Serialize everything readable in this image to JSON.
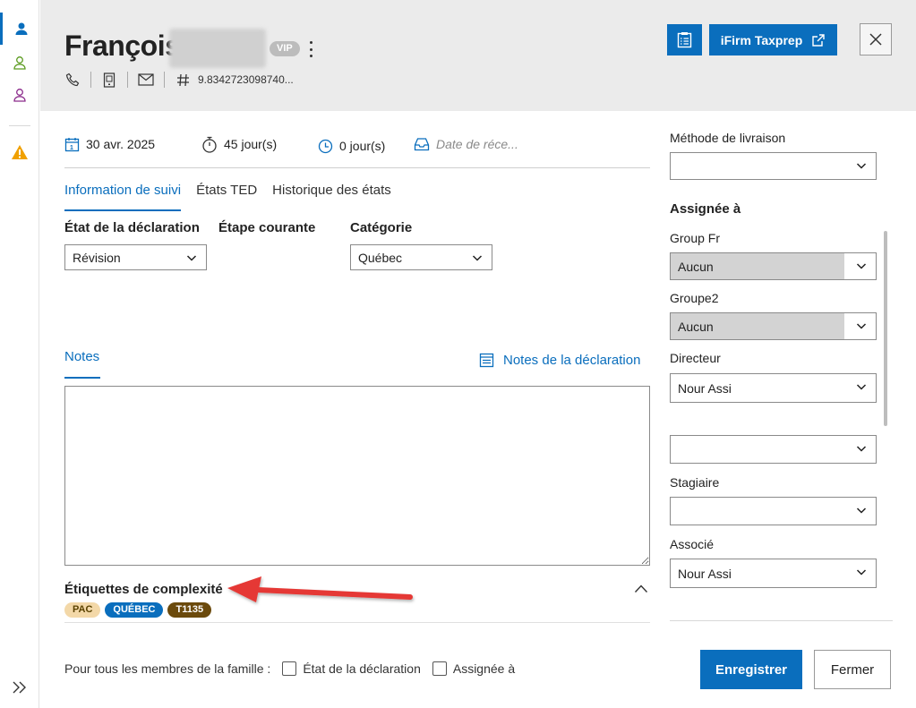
{
  "header": {
    "client_first_name": "François",
    "vip_badge": "VIP",
    "client_id": "9.8342723098740..."
  },
  "toolbar": {
    "ifirm_label": "iFirm Taxprep"
  },
  "dates": {
    "date": "30 avr. 2025",
    "days_elapsed": "45 jour(s)",
    "days_remaining": "0 jour(s)",
    "received_placeholder": "Date de réce..."
  },
  "tabs": [
    {
      "label": "Information de suivi"
    },
    {
      "label": "États TED"
    },
    {
      "label": "Historique des états"
    }
  ],
  "fields": {
    "state_label": "État de la déclaration",
    "state_value": "Révision",
    "step_label": "Étape courante",
    "category_label": "Catégorie",
    "category_value": "Québec"
  },
  "notes": {
    "tab_label": "Notes",
    "link_label": "Notes de la déclaration",
    "content": ""
  },
  "complexity": {
    "title": "Étiquettes de complexité",
    "tags": [
      {
        "label": "PAC",
        "bg": "#f3d8a8",
        "fg": "#5a4200"
      },
      {
        "label": "QUÉBEC",
        "bg": "#0a6ebd",
        "fg": "#ffffff"
      },
      {
        "label": "T1135",
        "bg": "#6b4a0c",
        "fg": "#ffffff"
      }
    ]
  },
  "family": {
    "label": "Pour tous les membres de la famille :",
    "cb1": "État de la déclaration",
    "cb2": "Assignée à"
  },
  "right_panel": {
    "delivery_label": "Méthode de livraison",
    "delivery_value": "",
    "assigned_title": "Assignée à",
    "group_fr_label": "Group Fr",
    "group_fr_value": "Aucun",
    "group2_label": "Groupe2",
    "group2_value": "Aucun",
    "director_label": "Directeur",
    "director_value": "Nour Assi",
    "unnamed_value": "",
    "intern_label": "Stagiaire",
    "intern_value": "",
    "partner_label": "Associé",
    "partner_value": "Nour Assi"
  },
  "actions": {
    "save": "Enregistrer",
    "close": "Fermer"
  },
  "colors": {
    "accent": "#0a6ebd",
    "header_bg": "#ebebeb",
    "warning": "#f0a000",
    "arrow": "#e53935"
  }
}
